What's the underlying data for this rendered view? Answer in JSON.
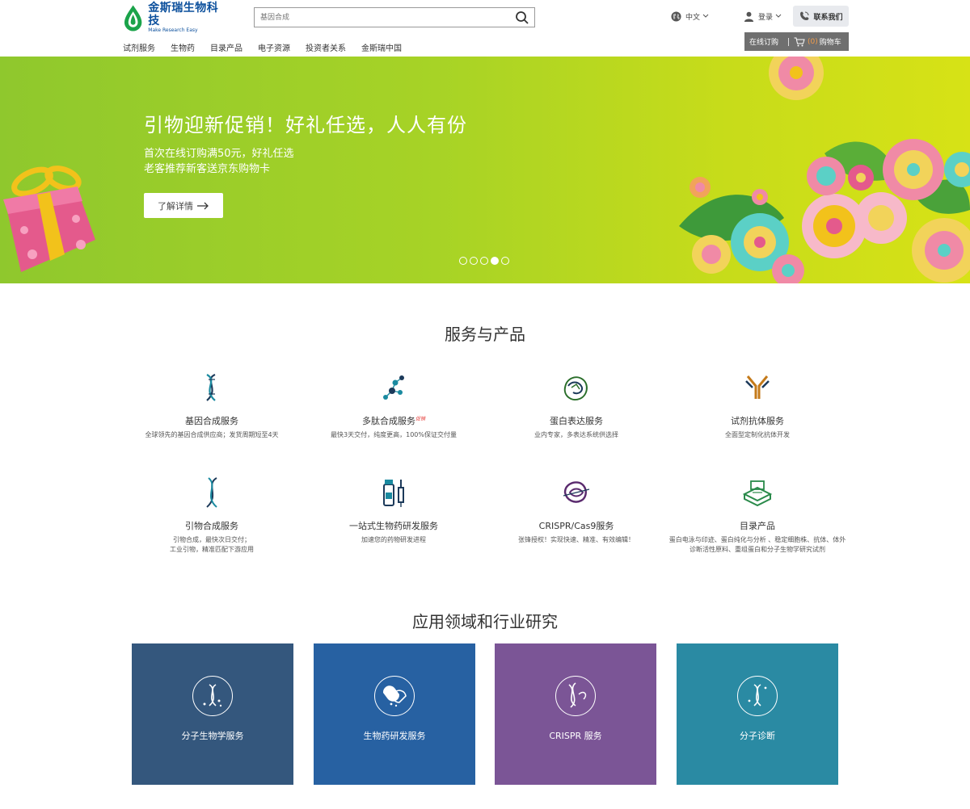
{
  "header": {
    "logo_name": "金斯瑞生物科技",
    "logo_slogan": "Make Research Easy",
    "search_placeholder": "基因合成",
    "lang_label": "中文",
    "login_label": "登录",
    "contact_label": "联系我们",
    "nav": [
      "试剂服务",
      "生物药",
      "目录产品",
      "电子资源",
      "投资者关系",
      "金斯瑞中国"
    ],
    "shop_order_label": "在线订购",
    "cart_count": "(0)",
    "cart_label": "购物车"
  },
  "banner": {
    "title": "引物迎新促销！好礼任选，人人有份",
    "sub1": "首次在线订购满50元，好礼任选",
    "sub2": "老客推荐新客送京东购物卡",
    "button_label": "了解详情",
    "slide_count": 5,
    "active_slide": 3
  },
  "services": {
    "title": "服务与产品",
    "items": [
      {
        "name": "基因合成服务",
        "desc": "全球领先的基因合成供应商；发货周期短至4天",
        "icon": "dna-helix-icon"
      },
      {
        "name": "多肽合成服务",
        "badge": "促销",
        "desc": "最快3天交付，纯度更高，100%保证交付量",
        "icon": "molecule-icon"
      },
      {
        "name": "蛋白表达服务",
        "desc": "业内专家，多表达系统供选择",
        "icon": "protein-icon"
      },
      {
        "name": "试剂抗体服务",
        "desc": "全面型定制化抗体开发",
        "icon": "antibody-icon"
      },
      {
        "name": "引物合成服务",
        "desc": "引物合成，最快次日交付；\n工业引物，精准匹配下游应用",
        "icon": "primer-helix-icon"
      },
      {
        "name": "一站式生物药研发服务",
        "desc": "加速您的药物研发进程",
        "icon": "vial-syringe-icon"
      },
      {
        "name": "CRISPR/Cas9服务",
        "desc": "张锋授权！实现快速、精准、有效编辑！",
        "icon": "crispr-icon"
      },
      {
        "name": "目录产品",
        "desc": "蛋白电泳与印迹、蛋白纯化与分析 、稳定细胞株、抗体、体外诊断活性原料、重组蛋白和分子生物学研究试剂",
        "icon": "catalog-machine-icon"
      }
    ]
  },
  "applications": {
    "title": "应用领域和行业研究",
    "items": [
      {
        "label": "分子生物学服务",
        "color": "#34577d",
        "icon": "dna-icon"
      },
      {
        "label": "生物药研发服务",
        "color": "#2761a2",
        "icon": "capsule-icon"
      },
      {
        "label": "CRISPR 服务",
        "color": "#7b5596",
        "icon": "crispr-dna-icon"
      },
      {
        "label": "分子诊断",
        "color": "#2a8aa3",
        "icon": "diagnostic-dna-icon"
      }
    ]
  }
}
